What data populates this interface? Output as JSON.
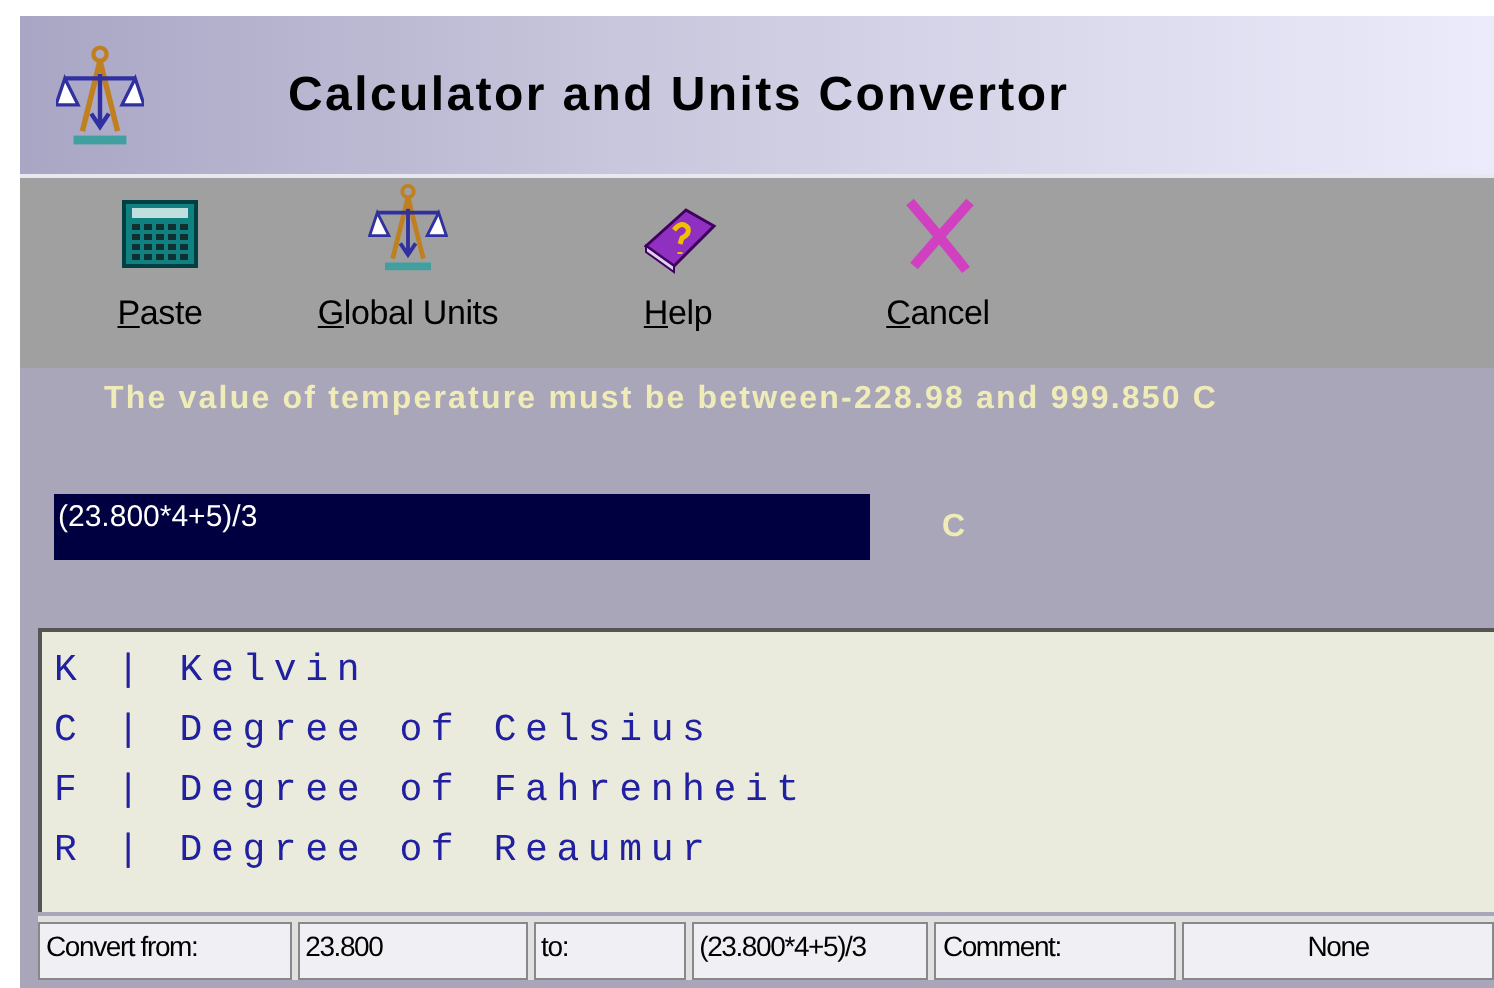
{
  "window": {
    "title": "Calculator and Units Convertor"
  },
  "toolbar": [
    {
      "label": "Paste",
      "kind": "calculator"
    },
    {
      "label": "Global Units",
      "kind": "scales"
    },
    {
      "label": "Help",
      "kind": "book"
    },
    {
      "label": "Cancel",
      "kind": "cross"
    }
  ],
  "message": "The value of  temperature must be between-228.98 and 999.850 C",
  "expression": {
    "value": "(23.800*4+5)/3",
    "unit": "C"
  },
  "units": [
    "K | Kelvin",
    "C | Degree of Celsius",
    "F | Degree of Fahrenheit",
    "R | Degree of Reaumur"
  ],
  "status_bar": [
    {
      "text": "Convert from:",
      "kind": "label"
    },
    {
      "text": "23.800",
      "kind": "value"
    },
    {
      "text": "to:",
      "kind": "label"
    },
    {
      "text": "(23.800*4+5)/3",
      "kind": "value"
    },
    {
      "text": "Comment:",
      "kind": "label"
    },
    {
      "text": "None",
      "kind": "value"
    }
  ]
}
